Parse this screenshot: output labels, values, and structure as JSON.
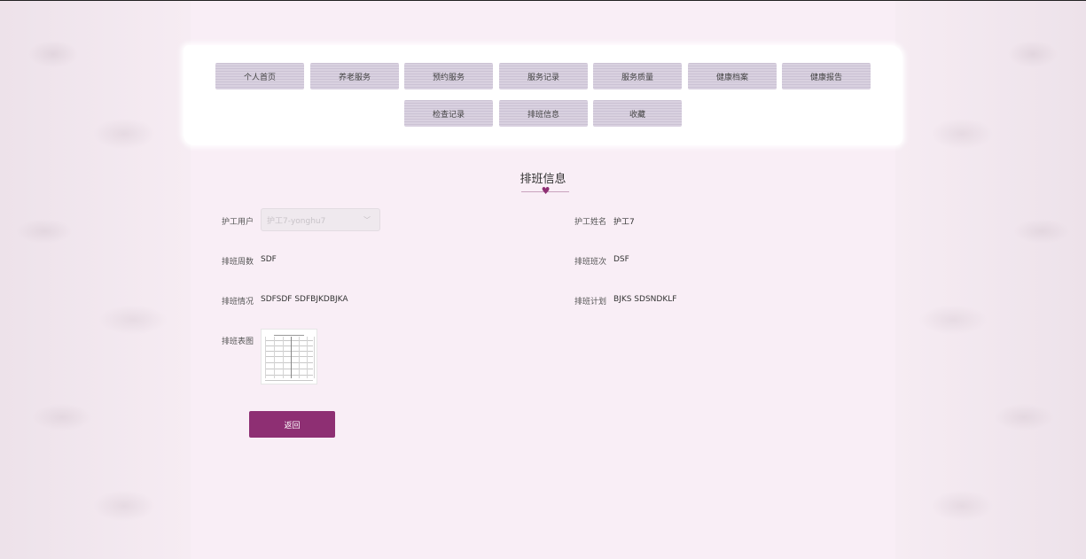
{
  "nav": {
    "items": [
      {
        "label": "个人首页"
      },
      {
        "label": "养老服务"
      },
      {
        "label": "预约服务"
      },
      {
        "label": "服务记录"
      },
      {
        "label": "服务质量"
      },
      {
        "label": "健康档案"
      },
      {
        "label": "健康报告"
      },
      {
        "label": "检查记录"
      },
      {
        "label": "排班信息"
      },
      {
        "label": "收藏"
      }
    ]
  },
  "page": {
    "title": "排班信息"
  },
  "fields": {
    "nurse_user": {
      "label": "护工用户",
      "value": "护工7-yonghu7"
    },
    "nurse_name": {
      "label": "护工姓名",
      "value": "护工7"
    },
    "schedule_weeks": {
      "label": "排班周数",
      "value": "SDF"
    },
    "schedule_shift": {
      "label": "排班班次",
      "value": "DSF"
    },
    "schedule_status": {
      "label": "排班情况",
      "value": "SDFSDF SDFBJKDBJKA"
    },
    "schedule_plan": {
      "label": "排班计划",
      "value": "BJKS SDSNDKLF"
    },
    "schedule_image": {
      "label": "排班表图"
    }
  },
  "actions": {
    "back_label": "返回"
  },
  "colors": {
    "accent": "#8e2f73",
    "background": "#f9eef6",
    "nav_button": "#d4cbdc"
  }
}
